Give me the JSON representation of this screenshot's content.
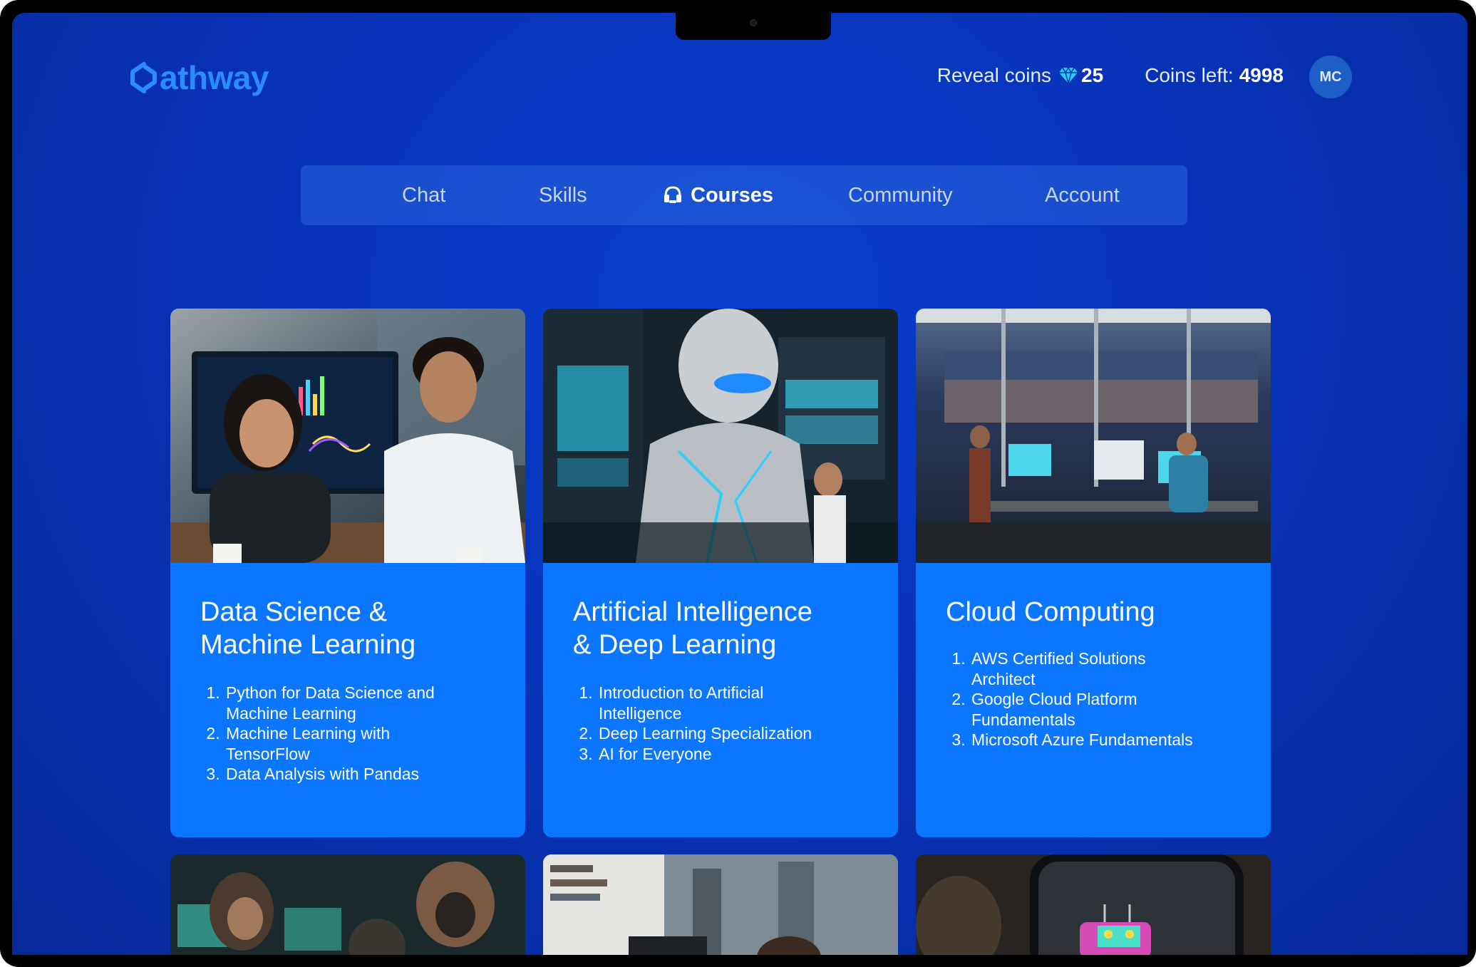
{
  "brand": {
    "name": "athway"
  },
  "header": {
    "reveal_label": "Reveal coins",
    "reveal_value": "25",
    "coins_label": "Coins left:",
    "coins_value": "4998",
    "avatar_initials": "MC"
  },
  "nav": {
    "items": [
      {
        "label": "Chat"
      },
      {
        "label": "Skills"
      },
      {
        "label": "Courses",
        "active": true,
        "icon": "headset-icon"
      },
      {
        "label": "Community"
      },
      {
        "label": "Account"
      }
    ]
  },
  "cards": [
    {
      "title_line1": "Data Science &",
      "title_line2": "Machine Learning",
      "image": "data-scientists-photo",
      "courses": [
        {
          "line1": "Python for Data Science and",
          "line2": "Machine Learning"
        },
        {
          "line1": "Machine Learning with",
          "line2": "TensorFlow"
        },
        {
          "line1": "Data Analysis with Pandas",
          "line2": ""
        }
      ]
    },
    {
      "title_line1": "Artificial Intelligence",
      "title_line2": "& Deep Learning",
      "image": "robot-server-room-photo",
      "courses": [
        {
          "line1": "Introduction to Artificial",
          "line2": "Intelligence"
        },
        {
          "line1": "Deep Learning Specialization",
          "line2": ""
        },
        {
          "line1": "AI for Everyone",
          "line2": ""
        }
      ]
    },
    {
      "title_line1": "Cloud Computing",
      "title_line2": "",
      "image": "city-office-photo",
      "courses": [
        {
          "line1": "AWS Certified Solutions",
          "line2": "Architect"
        },
        {
          "line1": "Google Cloud Platform",
          "line2": "Fundamentals"
        },
        {
          "line1": "Microsoft Azure Fundamentals",
          "line2": ""
        }
      ]
    }
  ],
  "colors": {
    "background": "#0733b8",
    "card": "#0b76ff",
    "brand": "#2a8cff",
    "gem": "#22d3ee"
  }
}
